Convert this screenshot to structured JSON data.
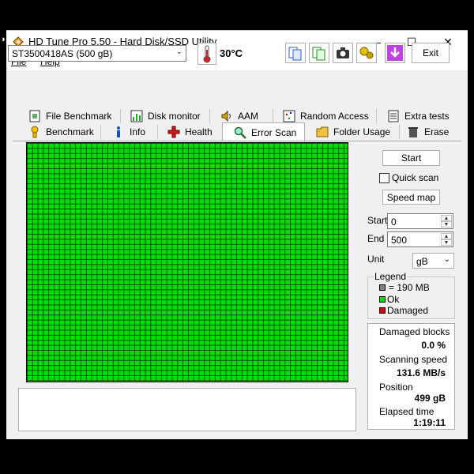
{
  "window": {
    "title": "HD Tune Pro 5.50 - Hard Disk/SSD Utility",
    "minimize_glyph": "—",
    "maximize_glyph": "☐",
    "close_glyph": "✕"
  },
  "menu": {
    "file": "File",
    "help": "Help"
  },
  "toolbar": {
    "drive": "ST3500418AS (500 gB)",
    "temperature": "30°C",
    "exit_label": "Exit",
    "icons": [
      "copy-info-icon",
      "copy-screenshot-icon",
      "camera-icon",
      "options-icon",
      "save-icon"
    ]
  },
  "tabs": {
    "row1": [
      "File Benchmark",
      "Disk monitor",
      "AAM",
      "Random Access",
      "Extra tests"
    ],
    "row2": [
      "Benchmark",
      "Info",
      "Health",
      "Error Scan",
      "Folder Usage",
      "Erase"
    ],
    "active": "Error Scan"
  },
  "scan": {
    "start_button": "Start",
    "quick_scan_label": "Quick scan",
    "quick_scan_checked": false,
    "speed_map_button": "Speed map",
    "start_label": "Start",
    "start_value": "0",
    "end_label": "End",
    "end_value": "500",
    "unit_label": "Unit",
    "unit_value": "gB"
  },
  "legend": {
    "title": "Legend",
    "block_size": "= 190 MB",
    "ok": "Ok",
    "damaged": "Damaged",
    "colors": {
      "block": "#808080",
      "ok": "#00e000",
      "damaged": "#e00000"
    }
  },
  "stats": {
    "damaged_blocks_label": "Damaged blocks",
    "damaged_blocks_value": "0.0 %",
    "scanning_speed_label": "Scanning speed",
    "scanning_speed_value": "131.6 MB/s",
    "position_label": "Position",
    "position_value": "499 gB",
    "elapsed_label": "Elapsed time",
    "elapsed_value": "1:19:11"
  }
}
